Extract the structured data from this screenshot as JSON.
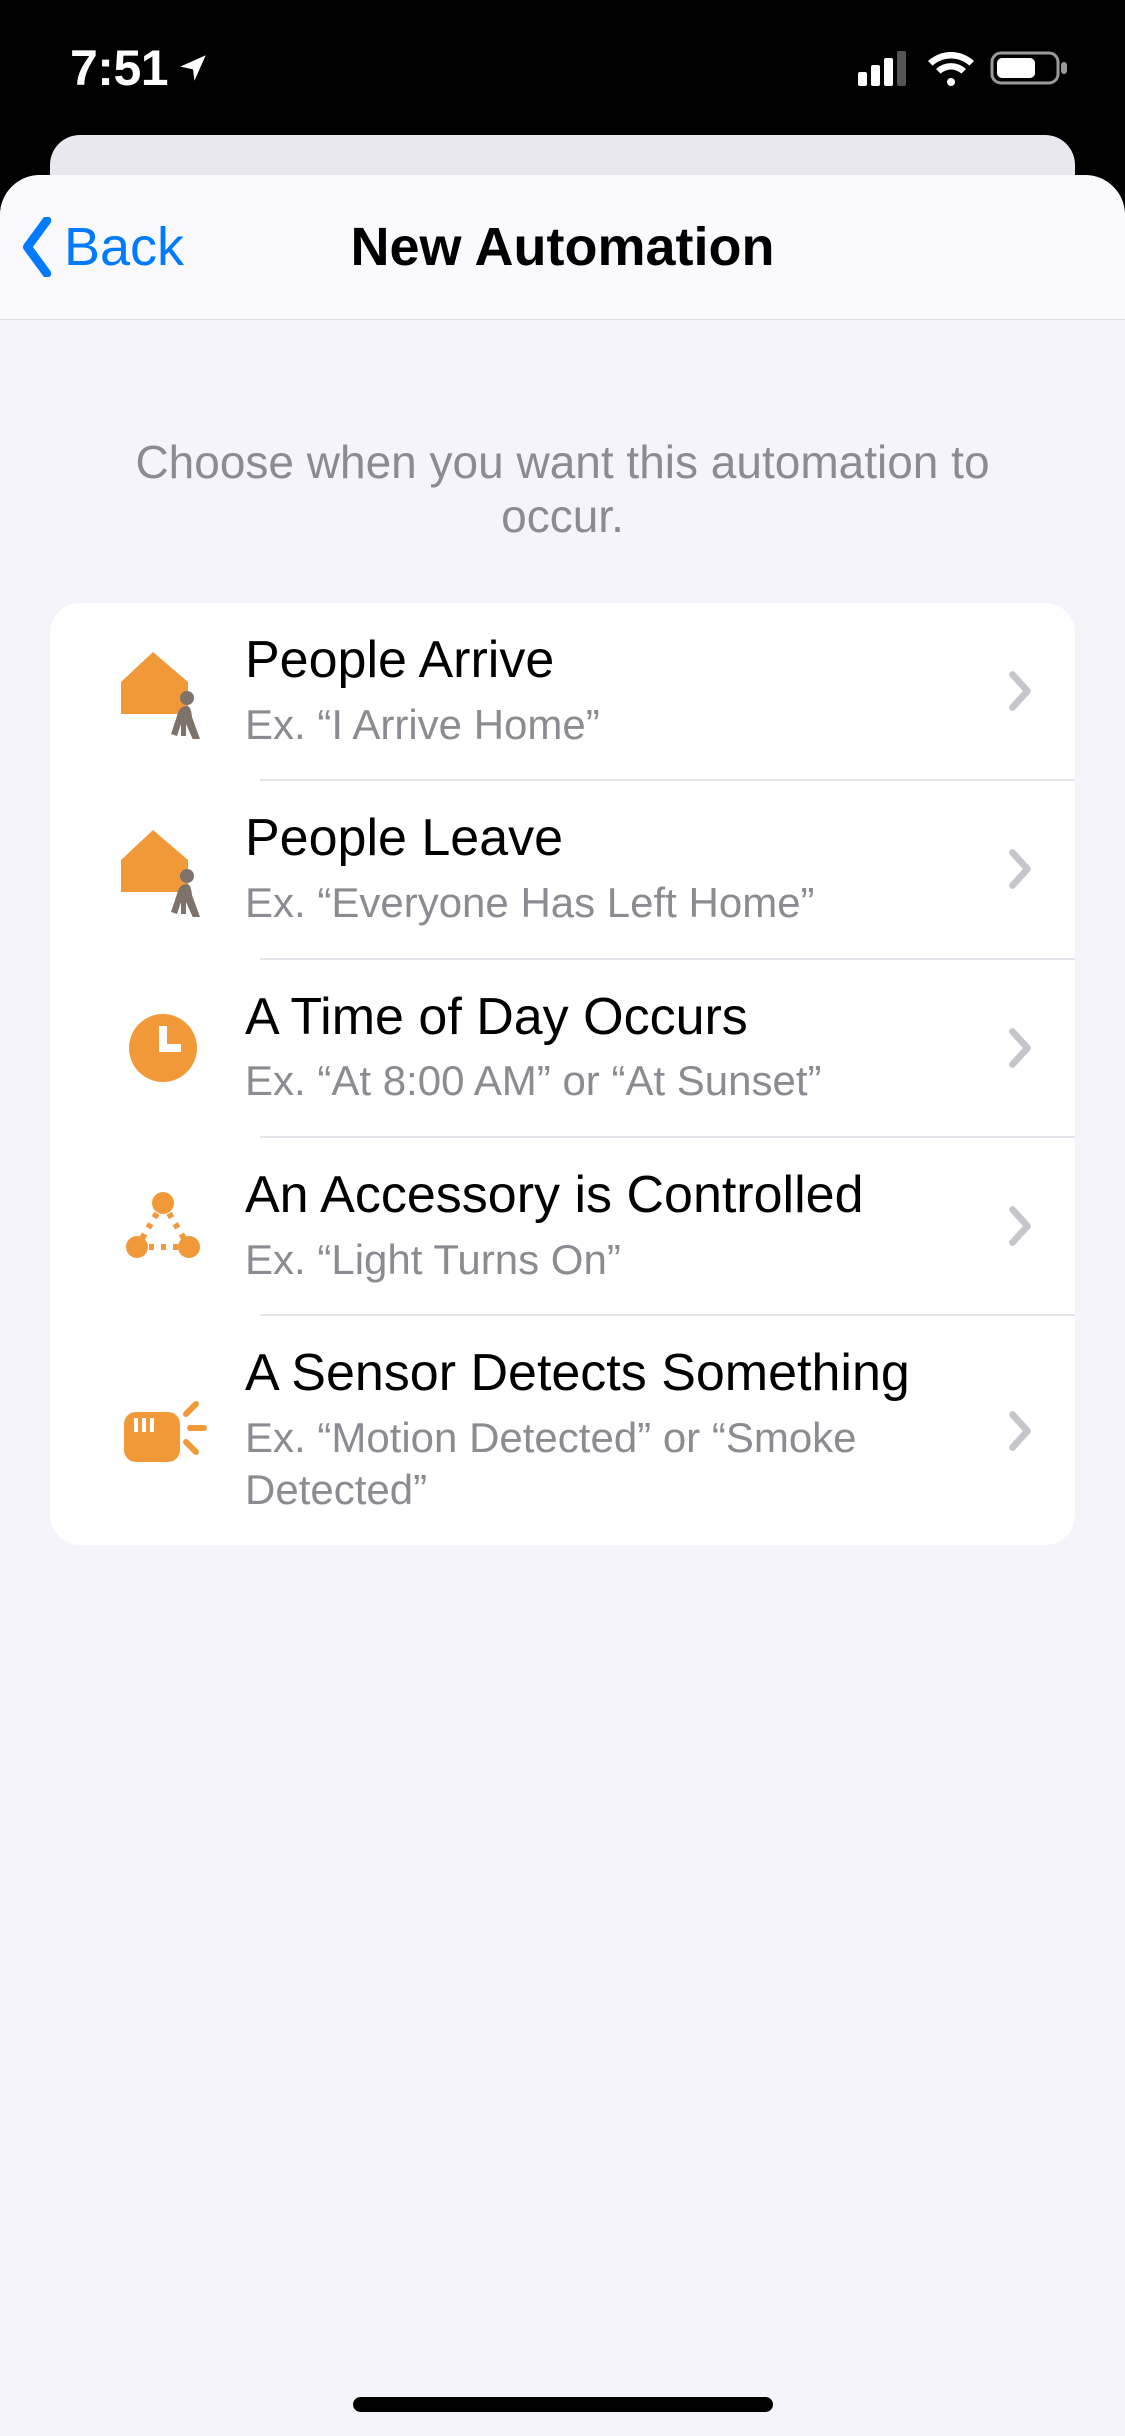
{
  "status": {
    "time": "7:51",
    "location_icon": "location-arrow-icon",
    "cellular_bars": 3,
    "wifi_icon": "wifi-icon",
    "battery_icon": "battery-icon"
  },
  "nav": {
    "back_label": "Back",
    "title": "New Automation"
  },
  "prompt": "Choose when you want this automation to occur.",
  "options": [
    {
      "icon": "house-person-icon",
      "title": "People Arrive",
      "subtitle": "Ex. “I Arrive Home”"
    },
    {
      "icon": "house-person-icon",
      "title": "People Leave",
      "subtitle": "Ex. “Everyone Has Left Home”"
    },
    {
      "icon": "clock-icon",
      "title": "A Time of Day Occurs",
      "subtitle": "Ex. “At 8:00 AM” or “At Sunset”"
    },
    {
      "icon": "accessory-icon",
      "title": "An Accessory is Controlled",
      "subtitle": "Ex. “Light Turns On”"
    },
    {
      "icon": "sensor-icon",
      "title": "A Sensor Detects Something",
      "subtitle": "Ex. “Motion Detected” or “Smoke Detected”"
    }
  ],
  "colors": {
    "accent_orange": "#f19938",
    "ios_blue": "#007aff",
    "secondary_text": "#8c8b91",
    "chevron": "#c6c5cb"
  }
}
